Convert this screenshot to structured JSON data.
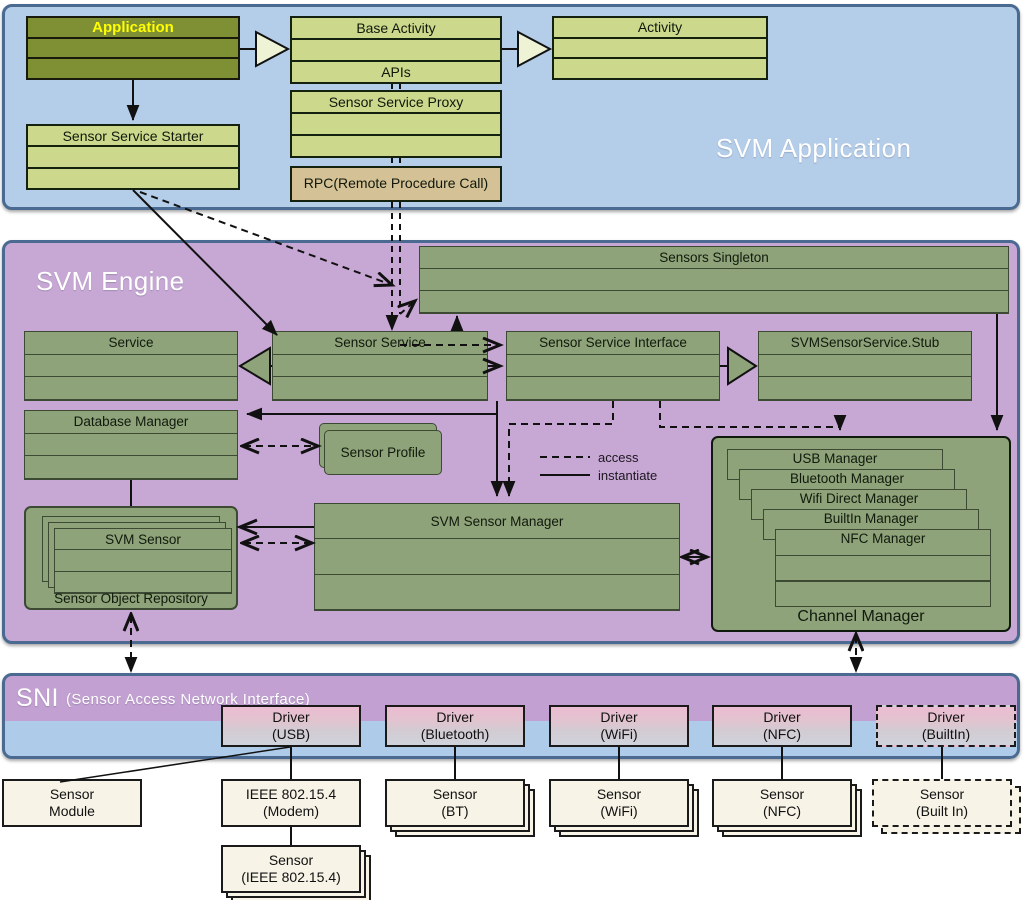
{
  "panels": {
    "application": {
      "title": "SVM Application"
    },
    "engine": {
      "title": "SVM Engine"
    },
    "sni": {
      "title": "SNI",
      "subtitle": "(Sensor Access Network Interface)"
    }
  },
  "application_layer": {
    "application_box": {
      "title": "Application"
    },
    "base_activity_box": {
      "title": "Base Activity",
      "row3": "APIs"
    },
    "activity_box": {
      "title": "Activity"
    },
    "sensor_service_starter_box": {
      "title": "Sensor Service Starter"
    },
    "sensor_service_proxy_box": {
      "title": "Sensor Service Proxy"
    },
    "rpc_box": {
      "title": "RPC(Remote Procedure Call)"
    }
  },
  "engine_layer": {
    "sensors_singleton_box": {
      "title": "Sensors Singleton"
    },
    "service_box": {
      "title": "Service"
    },
    "sensor_service_box": {
      "title": "Sensor Service"
    },
    "sensor_service_interface_box": {
      "title": "Sensor Service Interface"
    },
    "stub_box": {
      "title": "SVMSensorService.Stub"
    },
    "database_manager_box": {
      "title": "Database Manager"
    },
    "sensor_profile_box": {
      "title": "Sensor Profile"
    },
    "svm_sensor_box": {
      "title": "SVM Sensor"
    },
    "sensor_object_repository": {
      "label": "Sensor Object Repository"
    },
    "svm_sensor_manager_box": {
      "title": "SVM Sensor Manager"
    },
    "channel_manager": {
      "label": "Channel Manager",
      "managers": [
        "USB Manager",
        "Bluetooth  Manager",
        "Wifi Direct Manager",
        "BuiltIn Manager",
        "NFC Manager"
      ]
    },
    "legend": {
      "access": "access",
      "instantiate": "instantiate"
    }
  },
  "sni_layer": {
    "drivers": [
      {
        "line1": "Driver",
        "line2": "(USB)"
      },
      {
        "line1": "Driver",
        "line2": "(Bluetooth)"
      },
      {
        "line1": "Driver",
        "line2": "(WiFi)"
      },
      {
        "line1": "Driver",
        "line2": "(NFC)"
      },
      {
        "line1": "Driver",
        "line2": "(BuiltIn)"
      }
    ]
  },
  "device_layer": {
    "sensor_module": {
      "line1": "Sensor",
      "line2": "Module"
    },
    "modem": {
      "line1": "IEEE 802.15.4",
      "line2": "(Modem)"
    },
    "sensor_ieee": {
      "line1": "Sensor",
      "line2": "(IEEE 802.15.4)"
    },
    "sensor_bt": {
      "line1": "Sensor",
      "line2": "(BT)"
    },
    "sensor_wifi": {
      "line1": "Sensor",
      "line2": "(WiFi)"
    },
    "sensor_nfc": {
      "line1": "Sensor",
      "line2": "(NFC)"
    },
    "sensor_builtin": {
      "line1": "Sensor",
      "line2": "(Built In)"
    }
  },
  "colors": {
    "app_panel": "#b4cde8",
    "engine_panel": "#c7a8d4",
    "panel_border": "#4a6a92",
    "uml_green": "#ccd98c",
    "olive": "#7f8f34",
    "olive_text": "#ffff00",
    "tan": "#d4c195",
    "engine_green": "#8ea37a",
    "cream": "#f7f3e6"
  }
}
